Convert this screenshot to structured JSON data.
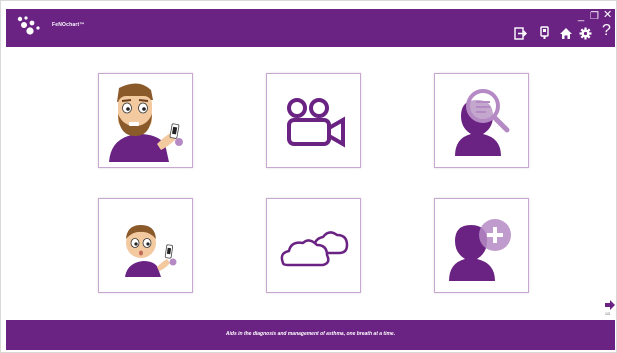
{
  "app": {
    "brand": "FeNOchart™",
    "tagline": "Aids in the diagnosis and management of asthma, one breath at a time.",
    "page_indicator": "1/3"
  },
  "colors": {
    "primary": "#6b2383",
    "accent": "#b58ac4",
    "skin": "#f3c9a0",
    "beard": "#8b5a2b",
    "tile_border": "#c8a8d3"
  },
  "header_icons": [
    {
      "name": "logout-icon",
      "glyph": "⇥"
    },
    {
      "name": "device-icon",
      "glyph": "▯"
    },
    {
      "name": "home-icon",
      "glyph": "⌂"
    },
    {
      "name": "settings-icon",
      "glyph": "⚙"
    },
    {
      "name": "help-icon",
      "glyph": "?"
    }
  ],
  "window_controls": {
    "minimize": "_",
    "restore": "❐",
    "close": "✕"
  },
  "tiles": [
    {
      "name": "adult-patient-tile",
      "icon": "adult-patient-icon"
    },
    {
      "name": "video-tile",
      "icon": "video-camera-icon"
    },
    {
      "name": "search-patient-tile",
      "icon": "search-patient-icon"
    },
    {
      "name": "child-patient-tile",
      "icon": "child-patient-icon"
    },
    {
      "name": "cloud-tile",
      "icon": "cloud-icon"
    },
    {
      "name": "add-patient-tile",
      "icon": "add-patient-icon"
    }
  ]
}
